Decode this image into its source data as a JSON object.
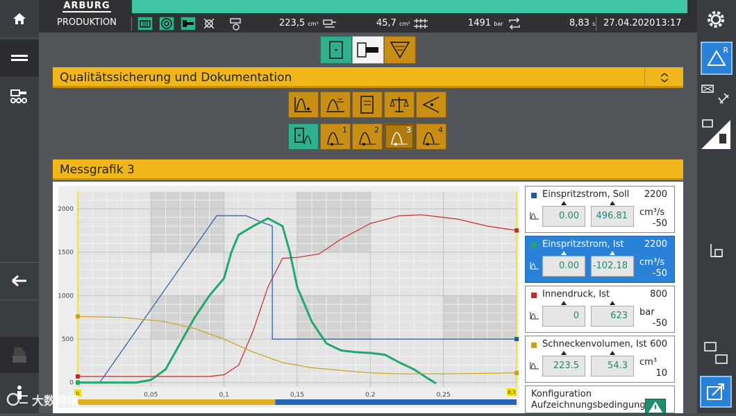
{
  "header": {
    "logo": "ARBURG",
    "mode": "PRODUKTION",
    "volume": "223,5",
    "volume_unit": "cm³",
    "speed": "45,7",
    "speed_unit": "cm³",
    "pressure": "1491",
    "pressure_unit": "bar",
    "cycle_time": "8,83",
    "cycle_unit": "s",
    "date": "27.04.2020",
    "time": "13:17"
  },
  "sections": {
    "quality_title": "Qualitätssicherung und Dokumentation",
    "graph_title": "Messgrafik 3"
  },
  "tabs": {
    "sub_numbers": [
      "1",
      "2",
      "3",
      "4"
    ]
  },
  "right_panel": {
    "r_label": "R"
  },
  "legend": [
    {
      "name": "Einspritzstrom, Soll",
      "max": "2200",
      "min": "-50",
      "unit": "cm³/s",
      "f1": "0.00",
      "f2": "496.81",
      "color": "#1f5aa0"
    },
    {
      "name": "Einspritzstrom, Ist",
      "max": "2200",
      "min": "-50",
      "unit": "cm³/s",
      "f1": "0.00",
      "f2": "-102.18",
      "color": "#20a86c"
    },
    {
      "name": "Innendruck, Ist",
      "max": "800",
      "min": "-50",
      "unit": "bar",
      "f1": "0",
      "f2": "623",
      "color": "#c8282a"
    },
    {
      "name": "Schneckenvolumen, Ist",
      "max": "600",
      "min": "10",
      "unit": "cm³",
      "f1": "223.5",
      "f2": "54.3",
      "color": "#c8a21a"
    }
  ],
  "config": {
    "line1": "Konfiguration",
    "line2": "Aufzeichnungsbedingung"
  },
  "watermark": "大数跨境",
  "chart_data": {
    "type": "line",
    "xlim": [
      0,
      0.3
    ],
    "ylim": [
      -50,
      2200
    ],
    "x_ticks": [
      "0",
      "0,05",
      "0,1",
      "0,15",
      "0,2",
      "0,25"
    ],
    "x_end_label": "0,3",
    "y_ticks": [
      "0",
      "500",
      "1000",
      "1500",
      "2000"
    ],
    "series": [
      {
        "name": "Einspritzstrom, Soll",
        "color": "#1f5aa0",
        "points": [
          [
            0.0,
            0
          ],
          [
            0.015,
            0
          ],
          [
            0.095,
            1920
          ],
          [
            0.115,
            1920
          ],
          [
            0.125,
            1850
          ],
          [
            0.133,
            1800
          ],
          [
            0.133,
            500
          ],
          [
            0.3,
            500
          ]
        ]
      },
      {
        "name": "Einspritzstrom, Ist",
        "color": "#20a86c",
        "points": [
          [
            0.0,
            0
          ],
          [
            0.04,
            0
          ],
          [
            0.05,
            30
          ],
          [
            0.06,
            150
          ],
          [
            0.07,
            450
          ],
          [
            0.08,
            750
          ],
          [
            0.09,
            1000
          ],
          [
            0.1,
            1200
          ],
          [
            0.105,
            1500
          ],
          [
            0.11,
            1700
          ],
          [
            0.12,
            1800
          ],
          [
            0.13,
            1890
          ],
          [
            0.14,
            1800
          ],
          [
            0.145,
            1500
          ],
          [
            0.15,
            1100
          ],
          [
            0.16,
            700
          ],
          [
            0.17,
            450
          ],
          [
            0.18,
            370
          ],
          [
            0.19,
            350
          ],
          [
            0.2,
            340
          ],
          [
            0.21,
            320
          ],
          [
            0.22,
            230
          ],
          [
            0.23,
            150
          ],
          [
            0.24,
            40
          ],
          [
            0.245,
            -10
          ]
        ]
      },
      {
        "name": "Innendruck, Ist",
        "color": "#c8282a",
        "points": [
          [
            0.0,
            70
          ],
          [
            0.09,
            70
          ],
          [
            0.1,
            90
          ],
          [
            0.11,
            200
          ],
          [
            0.12,
            600
          ],
          [
            0.13,
            1100
          ],
          [
            0.14,
            1430
          ],
          [
            0.15,
            1440
          ],
          [
            0.165,
            1480
          ],
          [
            0.18,
            1650
          ],
          [
            0.2,
            1830
          ],
          [
            0.22,
            1920
          ],
          [
            0.235,
            1930
          ],
          [
            0.26,
            1880
          ],
          [
            0.28,
            1800
          ],
          [
            0.3,
            1750
          ]
        ]
      },
      {
        "name": "Schneckenvolumen, Ist",
        "color": "#c8a21a",
        "points": [
          [
            0.0,
            760
          ],
          [
            0.03,
            750
          ],
          [
            0.06,
            700
          ],
          [
            0.08,
            620
          ],
          [
            0.1,
            500
          ],
          [
            0.12,
            350
          ],
          [
            0.14,
            230
          ],
          [
            0.16,
            170
          ],
          [
            0.18,
            140
          ],
          [
            0.2,
            110
          ],
          [
            0.22,
            100
          ],
          [
            0.25,
            100
          ],
          [
            0.3,
            110
          ]
        ]
      }
    ]
  }
}
